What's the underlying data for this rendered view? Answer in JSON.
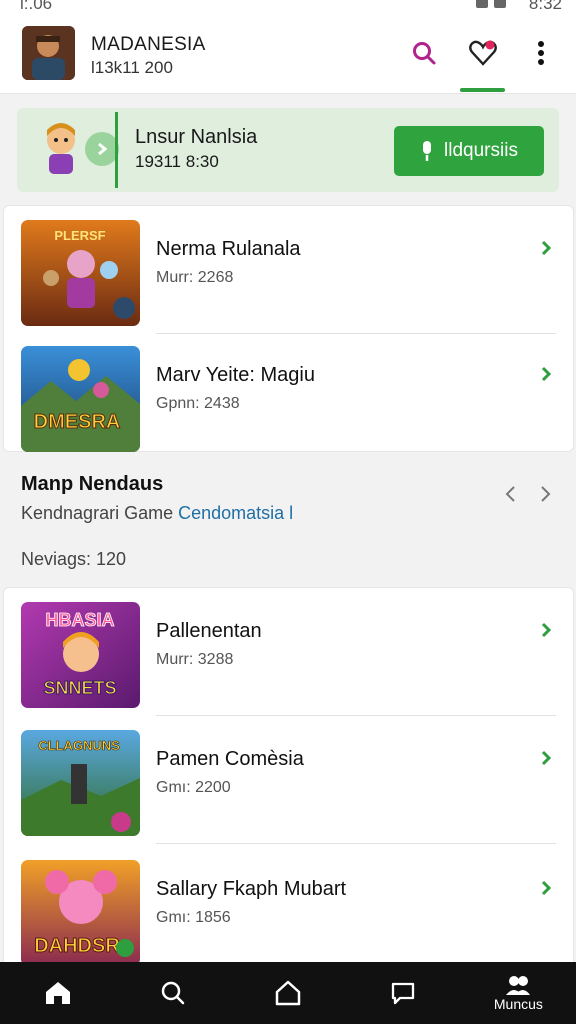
{
  "status_bar": {
    "time_left": "l:.06",
    "time_right": "8:32"
  },
  "header": {
    "title": "MADANESIA",
    "subtitle": "l13k11 200",
    "icons": [
      "search-icon",
      "heart-check-icon",
      "more-vert-icon"
    ],
    "accent": "#2e9e3e",
    "search_color": "#b0228c"
  },
  "banner": {
    "title": "Lnsur Nanlsia",
    "subtitle": "19311 8:30",
    "button_label": "lldqursiis",
    "background": "#dfeedd"
  },
  "top_list": [
    {
      "title": "Nerma Rulanala",
      "meta": "Murr: 2268",
      "thumb_text": "PLERSF"
    },
    {
      "title": "Marv Yeite: Magiu",
      "meta": "Gpnn: 2438",
      "thumb_text": "DMESRA"
    }
  ],
  "section": {
    "title": "Manp Nendaus",
    "subtitle": "Kendnagrari Game",
    "link": "Cendomatsia l",
    "count": "Neviags: 120"
  },
  "bottom_list": [
    {
      "title": "Pallenentan",
      "meta": "Murr: 3288",
      "thumb_text": "HBASIA",
      "thumb_text2": "SNNETS"
    },
    {
      "title": "Pamen Comèsia",
      "meta": "Gmı: 2200",
      "thumb_text": "CLLAGNUNS"
    },
    {
      "title": "Sallary Fkaph Mubart",
      "meta": "Gmı: 1856",
      "thumb_text": "DAHDSR"
    }
  ],
  "bottom_nav": {
    "items": [
      {
        "icon": "home-icon",
        "label": ""
      },
      {
        "icon": "search-icon",
        "label": ""
      },
      {
        "icon": "house-outline-icon",
        "label": ""
      },
      {
        "icon": "chat-icon",
        "label": ""
      },
      {
        "icon": "people-icon",
        "label": "Muncus"
      }
    ]
  }
}
